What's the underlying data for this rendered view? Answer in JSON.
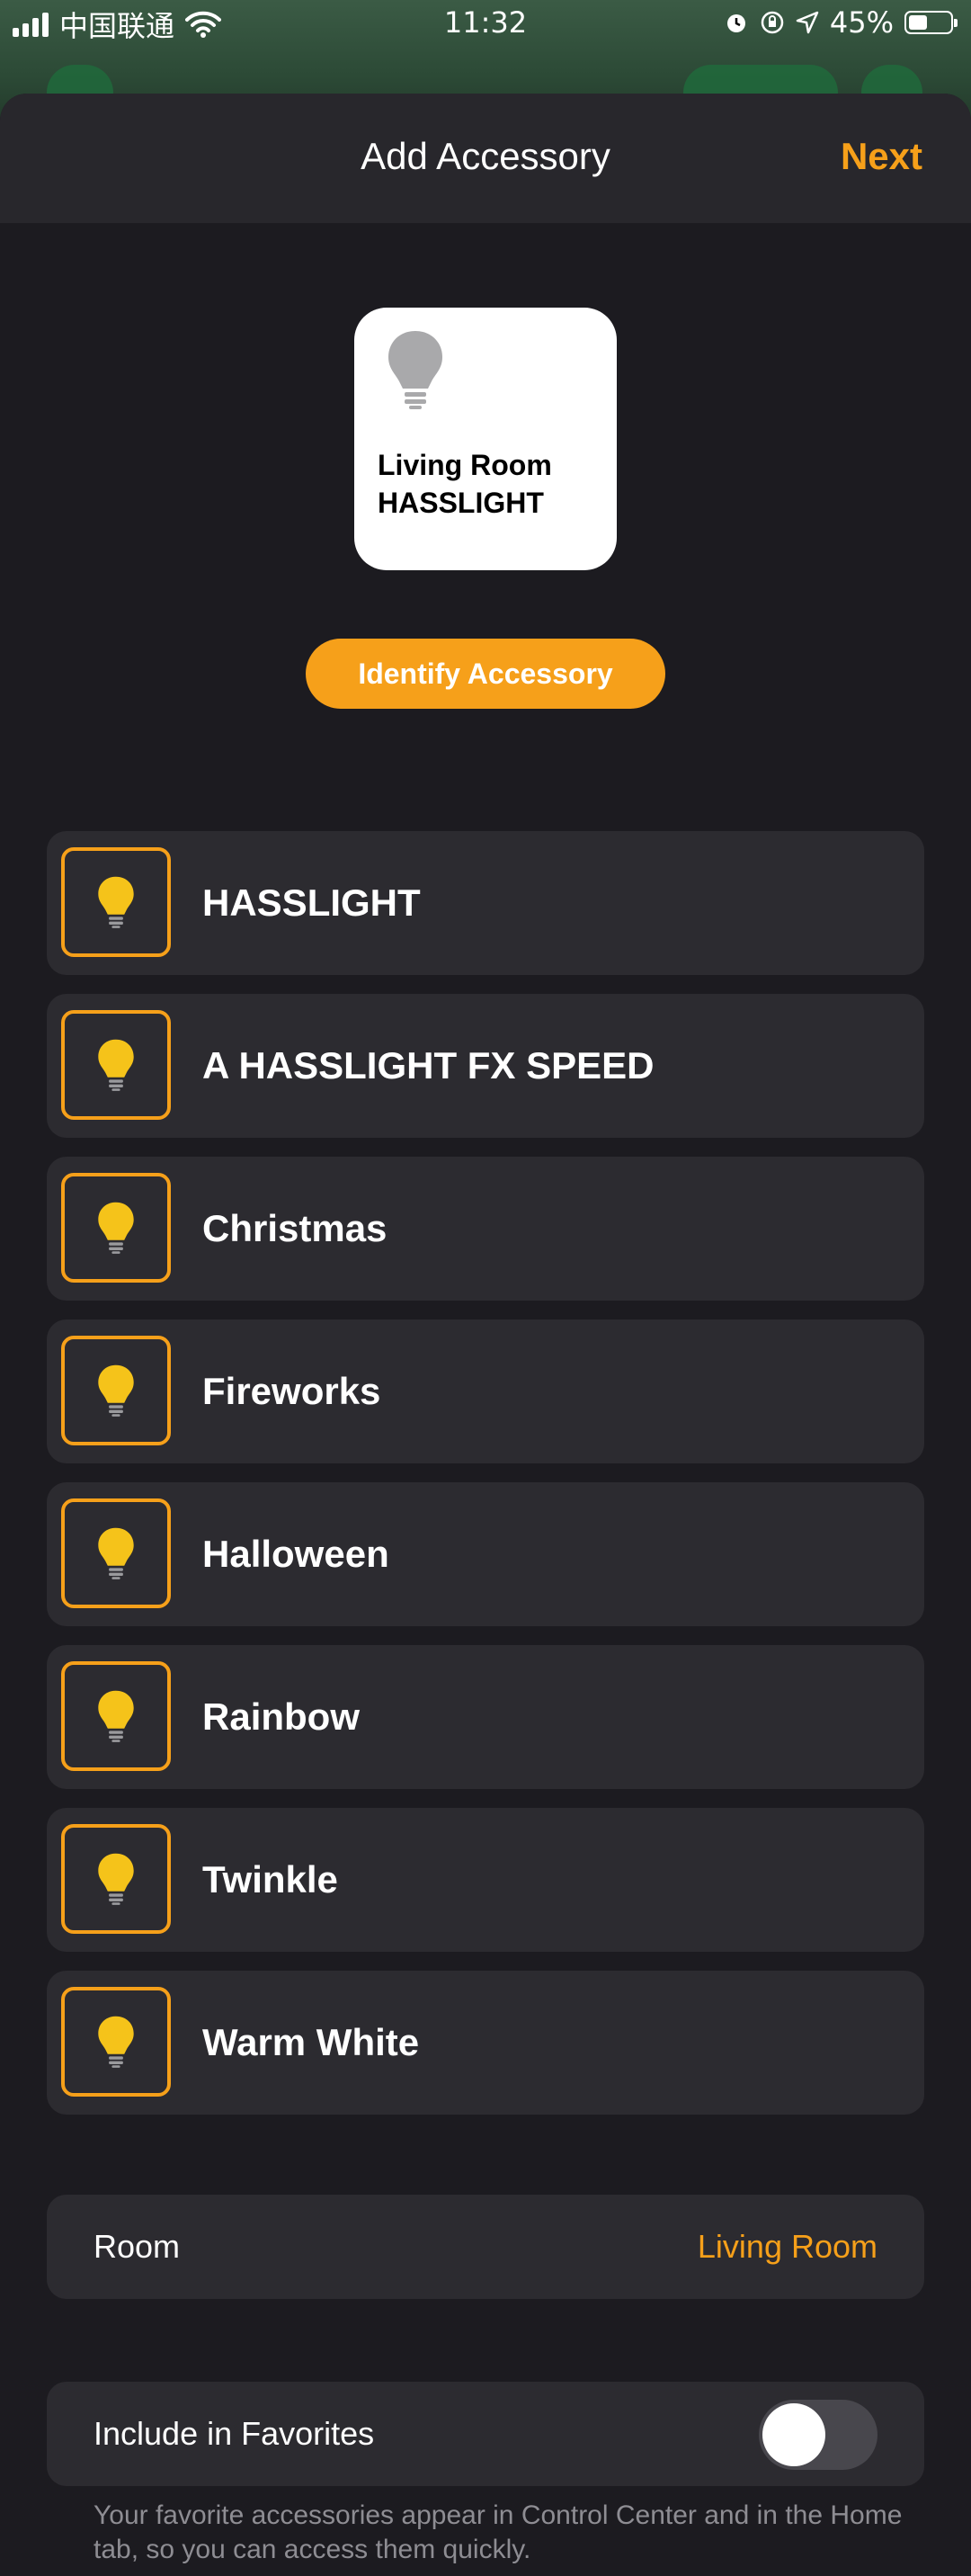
{
  "status_bar": {
    "carrier": "中国联通",
    "time": "11:32",
    "battery": "45%",
    "battery_level": 0.45,
    "icons": [
      "signal-icon",
      "wifi-icon",
      "alarm-icon",
      "rotation-lock-icon",
      "location-icon",
      "battery-icon"
    ]
  },
  "nav": {
    "title": "Add Accessory",
    "next_label": "Next"
  },
  "tile": {
    "name_line1": "Living Room",
    "name_line2": "HASSLIGHT",
    "icon": "lightbulb-icon"
  },
  "identify_label": "Identify Accessory",
  "accessories": [
    {
      "label": "HASSLIGHT"
    },
    {
      "label": "A HASSLIGHT FX SPEED"
    },
    {
      "label": "Christmas"
    },
    {
      "label": "Fireworks"
    },
    {
      "label": "Halloween"
    },
    {
      "label": "Rainbow"
    },
    {
      "label": "Twinkle"
    },
    {
      "label": "Warm White"
    }
  ],
  "room": {
    "label": "Room",
    "value": "Living Room"
  },
  "favorites": {
    "label": "Include in Favorites",
    "enabled": false,
    "footer": "Your favorite accessories appear in Control Center and in the Home tab, so you can access them quickly."
  },
  "colors": {
    "accent": "#f6a01a",
    "bulb": "#f5c31a",
    "background": "#1c1b20",
    "cell": "#2c2b30"
  }
}
